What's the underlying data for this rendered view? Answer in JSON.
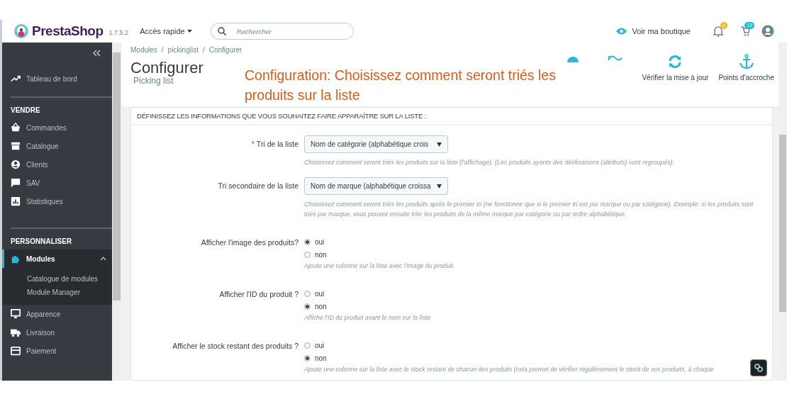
{
  "header": {
    "logo": "PrestaShop",
    "version": "1.7.5.2",
    "quick_access": "Accès rapide",
    "search": {
      "placeholder": "Rechercher"
    },
    "view_shop": "Voir ma boutique",
    "notifications": [
      {
        "count": "4",
        "color": "#fbbb22"
      },
      {
        "count": "13",
        "color": "#25b9d7"
      }
    ]
  },
  "sidebar": {
    "top": [
      {
        "label": "Tableau de bord",
        "selected": false
      }
    ],
    "sections": [
      {
        "title": "VENDRE",
        "items": [
          {
            "label": "Commandes",
            "selected": false
          },
          {
            "label": "Catalogue",
            "selected": false
          },
          {
            "label": "Clients",
            "selected": false
          },
          {
            "label": "SAV",
            "selected": false
          },
          {
            "label": "Statistiques",
            "selected": false
          }
        ]
      },
      {
        "title": "PERSONNALISER",
        "items": [
          {
            "label": "Modules",
            "selected": true,
            "expanded": true,
            "children": [
              {
                "label": "Catalogue de modules"
              },
              {
                "label": "Module Manager"
              }
            ]
          },
          {
            "label": "Apparence",
            "selected": false
          },
          {
            "label": "Livraison",
            "selected": false
          },
          {
            "label": "Paiement",
            "selected": false
          }
        ]
      }
    ]
  },
  "breadcrumb": {
    "separator": "/",
    "items": [
      "Modules",
      "pickinglist",
      "Configurer"
    ]
  },
  "title": "Configurer",
  "subtitle": "Picking list",
  "toolbar": [
    "Vérifier la mise à jour",
    "Points d'accroche"
  ],
  "caption": "Configuration: Choisissez comment seront triés les produits sur la liste",
  "panel": {
    "heading": "DÉFINISSEZ LES INFORMATIONS QUE VOUS SOUHAITEZ FAIRE APPARAÎTRE SUR LA LISTE :",
    "fields": [
      {
        "kind": "select",
        "required_mark": "*",
        "label": "Tri de la liste",
        "value": "Nom de catégorie (alphabétique crois",
        "hint": "Choisissez comment seront triés les produits sur la liste (l'affichage). (Les produits ayants des déclinaisons (attributs) sont regroupés)."
      },
      {
        "kind": "select",
        "label": "Tri secondaire de la liste",
        "value": "Nom de marque (alphabétique croissa",
        "hint": "Choisissez comment seront triés les produits après le premier tri (ne fonctionne que si le premier tri est par marque ou par catégorie). Exemple: si les produits sont triés par marque, vous pouvez ensuite trier les produits de la même marque par catégorie ou par ordre alphabétique."
      },
      {
        "kind": "radio",
        "label": "Afficher l'image des produits?",
        "options": [
          {
            "label": "oui",
            "selected": true
          },
          {
            "label": "non",
            "selected": false
          }
        ],
        "hint": "Ajoute une colonne sur la liste avec l'image du produit."
      },
      {
        "kind": "radio",
        "label": "Afficher l'ID du produit ?",
        "options": [
          {
            "label": "oui",
            "selected": false
          },
          {
            "label": "non",
            "selected": true
          }
        ],
        "hint": "Affiche l'ID du produit avant le nom sur la liste"
      },
      {
        "kind": "radio",
        "label": "Afficher le stock restant des produits ?",
        "options": [
          {
            "label": "oui",
            "selected": false
          },
          {
            "label": "non",
            "selected": true
          }
        ],
        "hint": "Ajoute une colonne sur la liste avec le stock restant de chacun des produits (cela permet de vérifier régulièrement le stock de vos produits, à chaque"
      }
    ]
  }
}
